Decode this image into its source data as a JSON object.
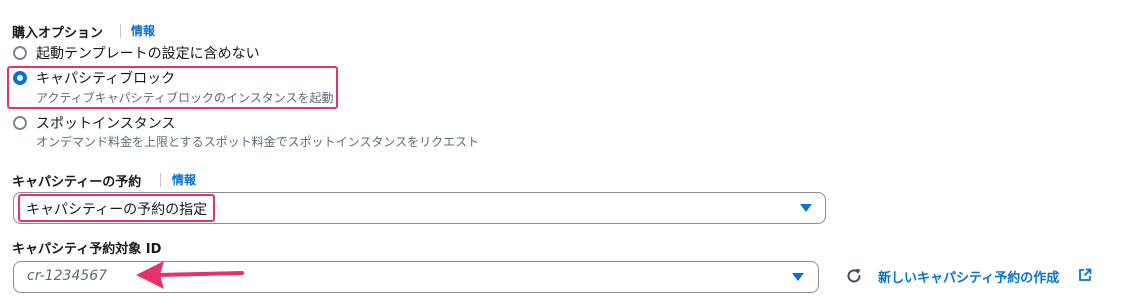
{
  "purchase_options": {
    "label": "購入オプション",
    "info": "情報",
    "options": [
      {
        "label": "起動テンプレートの設定に含めない",
        "description": "",
        "selected": false
      },
      {
        "label": "キャパシティブロック",
        "description": "アクティブキャパシティブロックのインスタンスを起動",
        "selected": true
      },
      {
        "label": "スポットインスタンス",
        "description": "オンデマンド料金を上限とするスポット料金でスポットインスタンスをリクエスト",
        "selected": false
      }
    ]
  },
  "capacity_reservation": {
    "label": "キャパシティーの予約",
    "info": "情報",
    "selected_value": "キャパシティーの予約の指定"
  },
  "reservation_id": {
    "label": "キャパシティ予約対象 ID",
    "placeholder": "cr-1234567",
    "create_link": "新しいキャパシティ予約の作成"
  },
  "colors": {
    "accent": "#0972d3",
    "highlight": "#e6316f"
  },
  "icons": {
    "refresh": "refresh-icon",
    "external": "external-link-icon",
    "caret": "caret-down-icon",
    "annotation_arrow": "arrow-left-icon"
  }
}
